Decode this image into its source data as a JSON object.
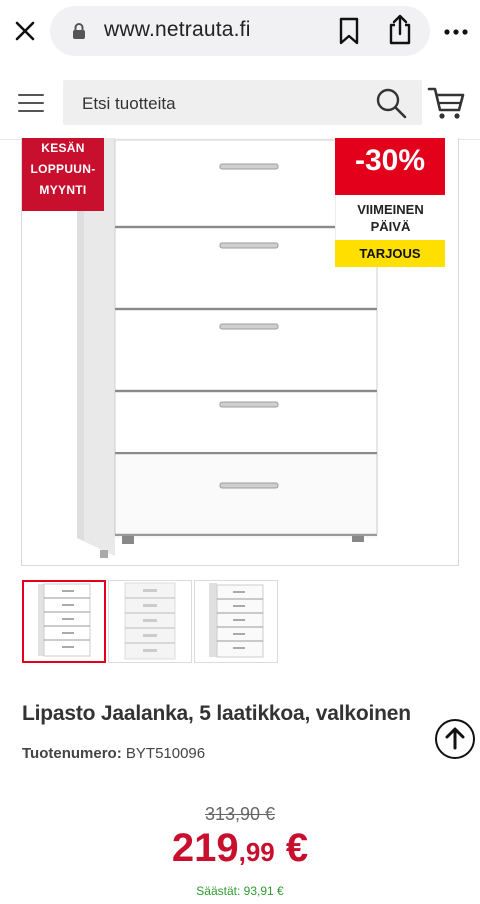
{
  "browser": {
    "url": "www.netrauta.fi",
    "icons": [
      "close-icon",
      "lock-icon",
      "bookmark-icon",
      "share-icon",
      "more-icon"
    ]
  },
  "header": {
    "search_placeholder": "Etsi tuotteita",
    "icons": [
      "menu-icon",
      "search-icon",
      "cart-icon"
    ]
  },
  "badges": {
    "sale_line1": "KESÄN",
    "sale_line2": "LOPPUUN-",
    "sale_line3": "MYYNTI",
    "discount": "-30%",
    "lastday_line1": "VIIMEINEN",
    "lastday_line2": "PÄIVÄ",
    "offer": "TARJOUS"
  },
  "product": {
    "title": "Lipasto Jaalanka, 5 laatikkoa, valkoinen",
    "sku_label": "Tuotenumero:",
    "sku_value": "BYT510096",
    "price_old": "313,90 €",
    "price_int": "219",
    "price_dec": ",99",
    "price_cur": " €",
    "savings": "Säästät: 93,91 €"
  },
  "colors": {
    "brand_red": "#c8102e",
    "discount_red": "#e3001b",
    "offer_yellow": "#ffdf00",
    "savings_green": "#2e9a2e"
  },
  "thumbnails": [
    {
      "name": "thumb-1",
      "selected": true
    },
    {
      "name": "thumb-2",
      "selected": false
    },
    {
      "name": "thumb-3",
      "selected": false
    }
  ]
}
